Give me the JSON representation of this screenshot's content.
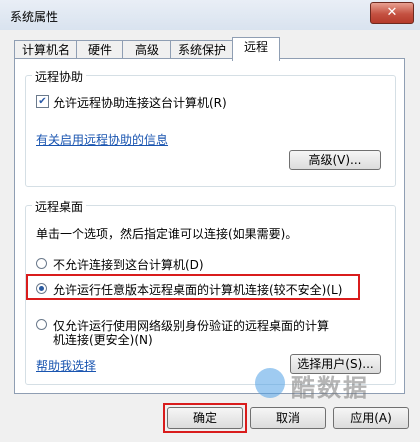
{
  "window": {
    "title": "系统属性",
    "close_label": "✕"
  },
  "tabs": [
    {
      "label": "计算机名"
    },
    {
      "label": "硬件"
    },
    {
      "label": "高级"
    },
    {
      "label": "系统保护"
    },
    {
      "label": "远程",
      "active": true
    }
  ],
  "remote_assistance": {
    "title": "远程协助",
    "allow_checkbox_label": "允许远程协助连接这台计算机(R)",
    "allow_checked": true,
    "info_link": "有关启用远程协助的信息",
    "advanced_button": "高级(V)..."
  },
  "remote_desktop": {
    "title": "远程桌面",
    "description": "单击一个选项，然后指定谁可以连接(如果需要)。",
    "options": [
      {
        "label": "不允许连接到这台计算机(D)",
        "checked": false
      },
      {
        "label": "允许运行任意版本远程桌面的计算机连接(较不安全)(L)",
        "checked": true
      },
      {
        "label": "仅允许运行使用网络级别身份验证的远程桌面的计算机连接(更安全)(N)",
        "line1": "仅允许运行使用网络级别身份验证的远程桌面的计算",
        "line2": "机连接(更安全)(N)",
        "checked": false
      }
    ],
    "help_link": "帮助我选择",
    "select_users_button": "选择用户(S)..."
  },
  "footer": {
    "ok_button": "确定",
    "cancel_button": "取消",
    "apply_button": "应用(A)"
  },
  "watermark": {
    "text": "酷数据"
  },
  "colors": {
    "highlight": "#d91c1c",
    "link": "#1a55b0"
  }
}
